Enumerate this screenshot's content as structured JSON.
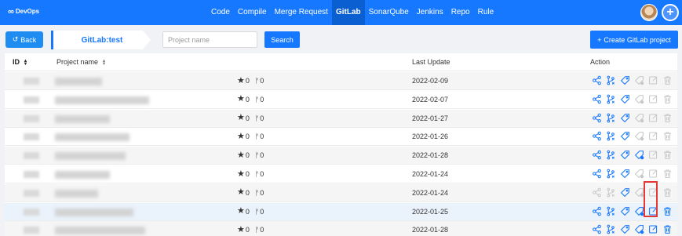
{
  "app": {
    "logo_text": "DevOps",
    "logo_symbol": "∞"
  },
  "nav": {
    "items": [
      {
        "label": "Code",
        "active": false
      },
      {
        "label": "Compile",
        "active": false
      },
      {
        "label": "Merge Request",
        "active": false
      },
      {
        "label": "GitLab",
        "active": true
      },
      {
        "label": "SonarQube",
        "active": false
      },
      {
        "label": "Jenkins",
        "active": false
      },
      {
        "label": "Repo",
        "active": false
      },
      {
        "label": "Rule",
        "active": false
      }
    ],
    "plus_symbol": "+"
  },
  "toolbar": {
    "back_label": "Back",
    "back_icon": "↺",
    "breadcrumb": "GitLab:test",
    "search_placeholder": "Project name",
    "search_label": "Search",
    "create_label": "Create GitLab project",
    "create_icon": "+"
  },
  "table": {
    "columns": {
      "id": "ID",
      "name": "Project name",
      "last_update": "Last Update",
      "action": "Action"
    },
    "rows": [
      {
        "stars": "0",
        "forks": "0",
        "last_update": "2022-02-09",
        "name_blur_w": 60,
        "actions_enabled": [
          true,
          true,
          true,
          false,
          false,
          false
        ]
      },
      {
        "stars": "0",
        "forks": "0",
        "last_update": "2022-02-07",
        "name_blur_w": 120,
        "actions_enabled": [
          true,
          true,
          true,
          false,
          false,
          false
        ]
      },
      {
        "stars": "0",
        "forks": "0",
        "last_update": "2022-01-27",
        "name_blur_w": 70,
        "actions_enabled": [
          true,
          true,
          true,
          false,
          false,
          false
        ]
      },
      {
        "stars": "0",
        "forks": "0",
        "last_update": "2022-01-26",
        "name_blur_w": 95,
        "actions_enabled": [
          true,
          true,
          true,
          false,
          false,
          false
        ]
      },
      {
        "stars": "0",
        "forks": "0",
        "last_update": "2022-01-28",
        "name_blur_w": 90,
        "actions_enabled": [
          true,
          true,
          true,
          true,
          false,
          false
        ]
      },
      {
        "stars": "0",
        "forks": "0",
        "last_update": "2022-01-24",
        "name_blur_w": 70,
        "actions_enabled": [
          true,
          true,
          true,
          false,
          false,
          false
        ]
      },
      {
        "stars": "0",
        "forks": "0",
        "last_update": "2022-01-24",
        "name_blur_w": 55,
        "actions_enabled": [
          false,
          false,
          true,
          false,
          false,
          false
        ]
      },
      {
        "stars": "0",
        "forks": "0",
        "last_update": "2022-01-25",
        "name_blur_w": 100,
        "actions_enabled": [
          true,
          true,
          true,
          true,
          true,
          true
        ]
      },
      {
        "stars": "0",
        "forks": "0",
        "last_update": "2022-01-28",
        "name_blur_w": 115,
        "actions_enabled": [
          true,
          true,
          true,
          true,
          true,
          true
        ]
      }
    ],
    "action_icons": [
      "share-icon",
      "branch-icon",
      "tag-icon",
      "tag-search-icon",
      "edit-icon",
      "delete-icon"
    ]
  },
  "colors": {
    "primary": "#1677ff",
    "highlight": "#e53935"
  }
}
